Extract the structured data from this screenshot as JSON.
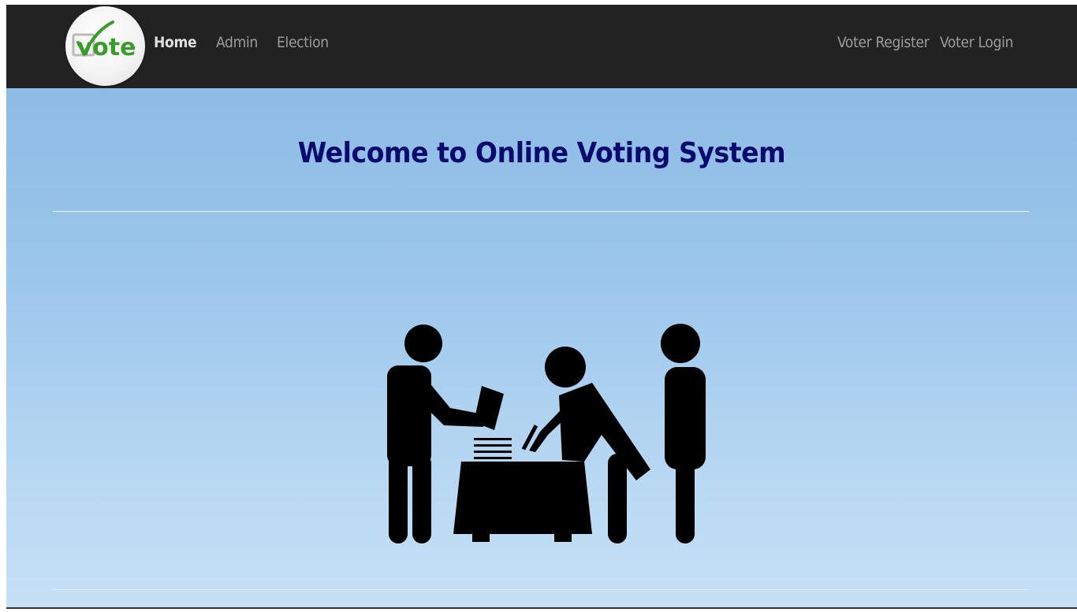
{
  "brand": {
    "logo_text": "vote",
    "logo_color": "#3a9a2a"
  },
  "navbar": {
    "left_links": [
      {
        "label": "Home",
        "active": true
      },
      {
        "label": "Admin",
        "active": false
      },
      {
        "label": "Election",
        "active": false
      }
    ],
    "right_links": [
      {
        "label": "Voter Register"
      },
      {
        "label": "Voter Login"
      }
    ]
  },
  "main": {
    "title": "Welcome to Online Voting System",
    "illustration": "voting-people-icon"
  },
  "colors": {
    "navbar_bg": "#222222",
    "title": "#0a0a6e",
    "background_top": "#86b7e3",
    "background_bottom": "#c6e0f6",
    "nav_text": "#9d9d9d",
    "nav_active_text": "#e0e0e0"
  }
}
